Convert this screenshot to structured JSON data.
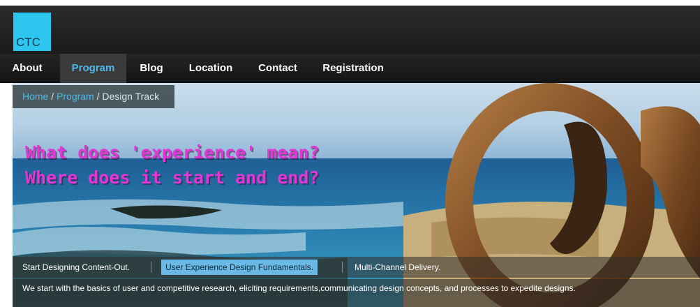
{
  "header": {
    "logo_text": "CTC"
  },
  "nav": {
    "items": [
      {
        "label": "About"
      },
      {
        "label": "Program"
      },
      {
        "label": "Blog"
      },
      {
        "label": "Location"
      },
      {
        "label": "Contact"
      },
      {
        "label": "Registration"
      }
    ],
    "active": "Program"
  },
  "breadcrumb": {
    "home": "Home",
    "sep1": " / ",
    "program": "Program",
    "sep2": " / ",
    "current": "Design Track"
  },
  "hero": {
    "headline_line1": "What does 'experience' mean?",
    "headline_line2": "Where does it start and end?"
  },
  "tabs": [
    {
      "label": "Start Designing Content-Out."
    },
    {
      "label": "User Experience Design Fundamentals."
    },
    {
      "label": "Multi-Channel Delivery."
    }
  ],
  "description": "We start with the basics of user and competitive research, eliciting requirements,communicating design concepts, and processes to expedite designs.",
  "colors": {
    "accent": "#2ec5ef",
    "nav_active_text": "#4fb8e6",
    "headline": "#e236d6"
  }
}
